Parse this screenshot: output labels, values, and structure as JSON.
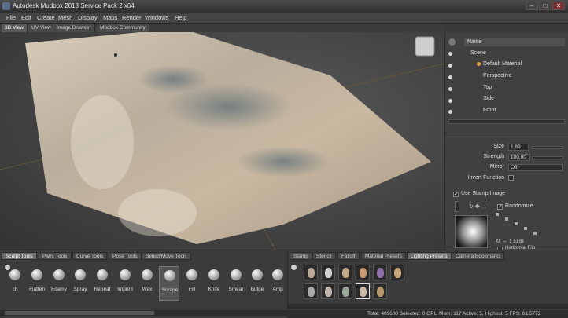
{
  "window": {
    "title": "Autodesk Mudbox 2013 Service Pack 2 x64"
  },
  "menu": [
    "File",
    "Edit",
    "Create",
    "Mesh",
    "Display",
    "Maps",
    "Render",
    "Windows",
    "Help"
  ],
  "view_tabs": [
    "3D View",
    "UV View",
    "Image Browser",
    "Mudbox Community"
  ],
  "outliner": {
    "header": "Name",
    "items": [
      "Scene",
      "Default Material",
      "Perspective",
      "Top",
      "Side",
      "Front"
    ]
  },
  "properties": {
    "size_label": "Size",
    "size_value": "1,89",
    "strength_label": "Strength",
    "strength_value": "100,00",
    "mirror_label": "Mirror",
    "mirror_value": "Off",
    "invert_label": "Invert Function",
    "use_stamp_label": "Use Stamp Image",
    "randomize_label": "Randomize",
    "horizontal_flip_label": "Horizontal Flip"
  },
  "sculpt_tabs": [
    "Sculpt Tools",
    "Paint Tools",
    "Curve Tools",
    "Pose Tools",
    "Select/Move Tools"
  ],
  "sculpt_tools": [
    "ch",
    "Flatten",
    "Foamy",
    "Spray",
    "Repeat",
    "Imprint",
    "Wax",
    "Scrape",
    "Fill",
    "Knife",
    "Smear",
    "Bulge",
    "Amp"
  ],
  "preset_tabs": [
    "Stamp",
    "Stencil",
    "Falloff",
    "Material Presets",
    "Lighting Presets",
    "Camera Bookmarks"
  ],
  "status_text": "Total: 409600  Selected: 0 GPU Mem: 117  Active: 5, Highest: 5  FPS: 61.5772",
  "colors": {
    "accent": "#e0a040",
    "panel": "#404040",
    "viewport": "#4a4a4a"
  }
}
